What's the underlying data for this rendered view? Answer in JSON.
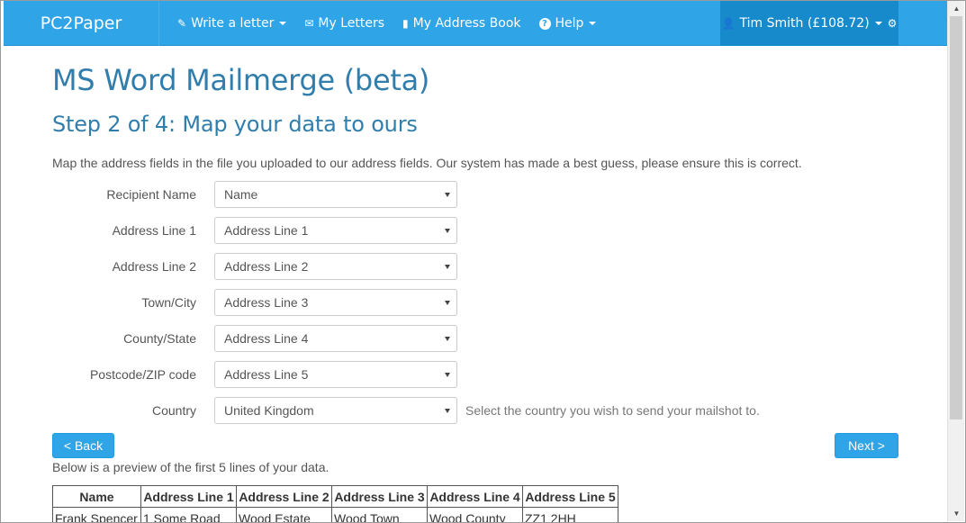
{
  "navbar": {
    "brand": "PC2Paper",
    "items": [
      {
        "label": "Write a letter",
        "icon": "pencil-icon",
        "glyph": "✎",
        "dropdown": true
      },
      {
        "label": "My Letters",
        "icon": "envelope-icon",
        "glyph": "✉",
        "dropdown": false
      },
      {
        "label": "My Address Book",
        "icon": "book-icon",
        "glyph": "▮",
        "dropdown": false
      },
      {
        "label": "Help",
        "icon": "question-circle-icon",
        "glyph": "?",
        "dropdown": true
      }
    ],
    "user": {
      "label": "Tim Smith (£108.72)",
      "icon": "user-icon",
      "glyph": "👤",
      "settings_glyph": "⚙"
    }
  },
  "page": {
    "title": "MS Word Mailmerge (beta)",
    "step_title": "Step 2 of 4: Map your data to ours",
    "intro": "Map the address fields in the file you uploaded to our address fields. Our system has made a best guess, please ensure this is correct."
  },
  "form": {
    "fields": [
      {
        "label": "Recipient Name",
        "value": "Name"
      },
      {
        "label": "Address Line 1",
        "value": "Address Line 1"
      },
      {
        "label": "Address Line 2",
        "value": "Address Line 2"
      },
      {
        "label": "Town/City",
        "value": "Address Line 3"
      },
      {
        "label": "County/State",
        "value": "Address Line 4"
      },
      {
        "label": "Postcode/ZIP code",
        "value": "Address Line 5"
      },
      {
        "label": "Country",
        "value": "United Kingdom",
        "help": "Select the country you wish to send your mailshot to."
      }
    ]
  },
  "buttons": {
    "back": "< Back",
    "next": "Next >"
  },
  "preview": {
    "caption": "Below is a preview of the first 5 lines of your data.",
    "headers": [
      "Name",
      "Address Line 1",
      "Address Line 2",
      "Address Line 3",
      "Address Line 4",
      "Address Line 5"
    ],
    "rows": [
      [
        "Frank Spencer",
        "1 Some Road",
        "Wood Estate",
        "Wood Town",
        "Wood County",
        "ZZ1 2HH"
      ]
    ]
  },
  "colors": {
    "accent": "#2fa4e7",
    "heading": "#317eac",
    "user_menu_bg": "#178acc"
  }
}
